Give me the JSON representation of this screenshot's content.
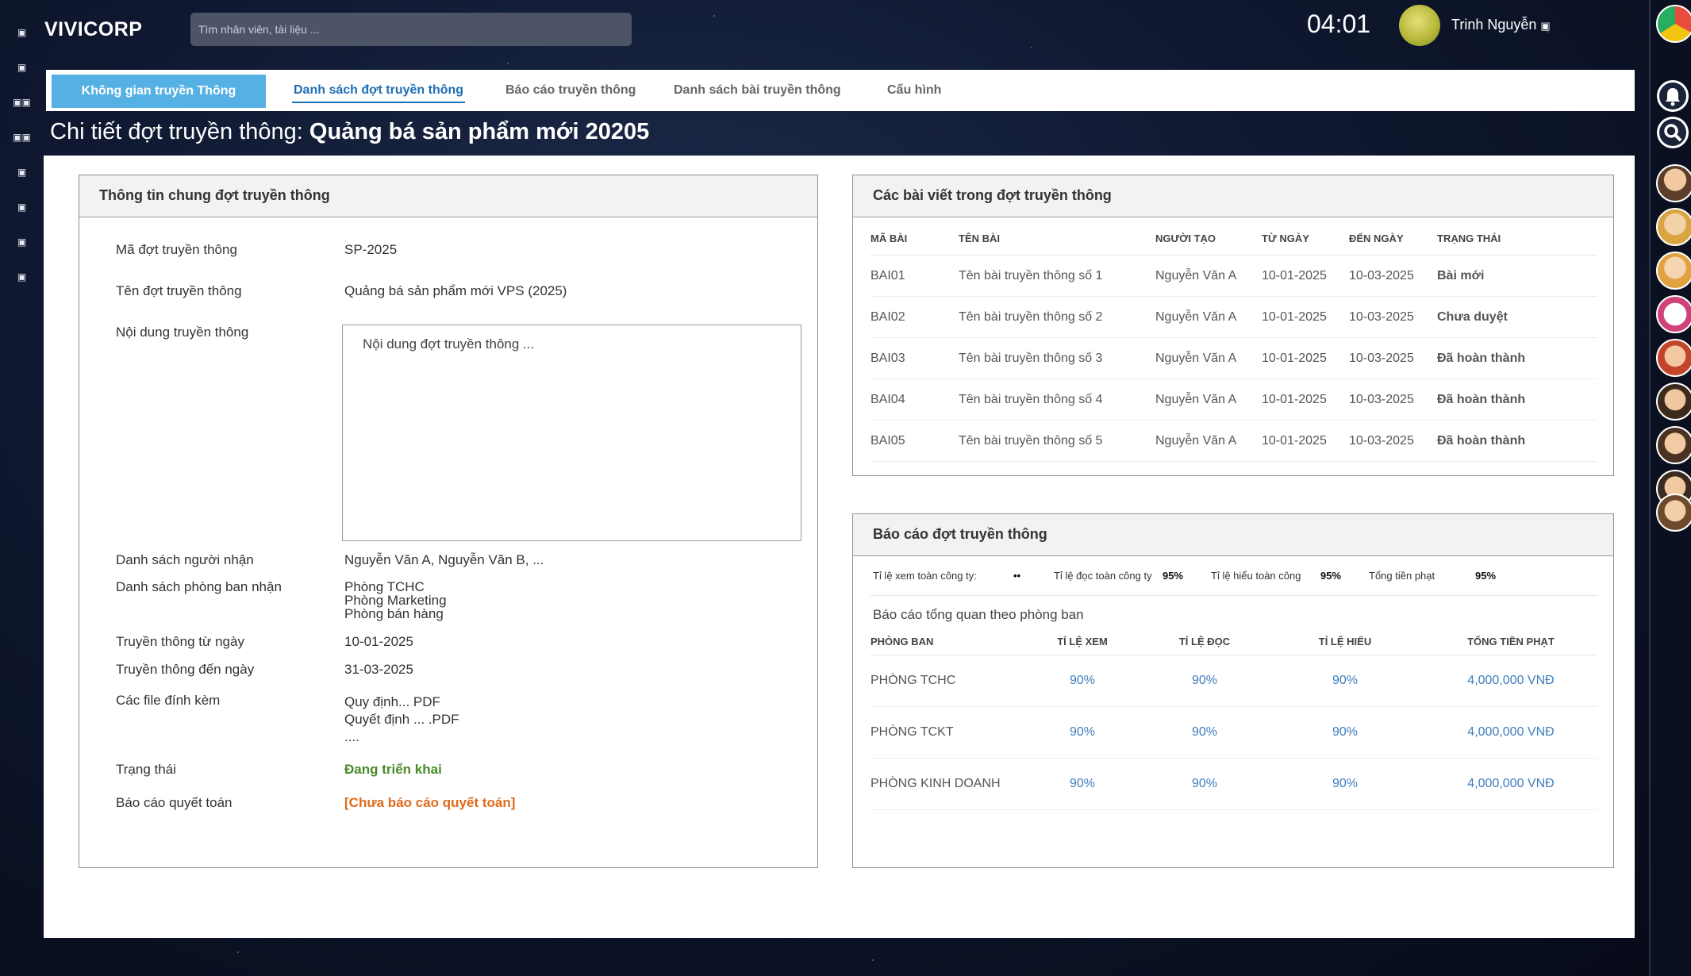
{
  "app": {
    "brand": "VIVICORP",
    "search_placeholder": "Tìm nhân viên, tài liệu ...",
    "clock": "04:01",
    "user_name": "Trinh Nguyễn"
  },
  "tabs": [
    {
      "label": "Không gian truyền Thông",
      "state": "active"
    },
    {
      "label": "Danh sách đợt truyền thông",
      "state": "current"
    },
    {
      "label": "Báo cáo truyền thông",
      "state": "normal"
    },
    {
      "label": "Danh sách bài truyền thông",
      "state": "normal"
    },
    {
      "label": "Cấu hình",
      "state": "normal"
    }
  ],
  "page": {
    "title_prefix": "Chi tiết đợt truyền thông:",
    "title_name": "Quảng bá sản phẩm mới 20205"
  },
  "general": {
    "header": "Thông tin chung đợt truyền thông",
    "code_label": "Mã đợt truyền thông",
    "code_value": "SP-2025",
    "name_label": "Tên đợt truyền thông",
    "name_value": "Quảng bá sản phẩm mới VPS (2025)",
    "content_label": "Nội dung truyền thông",
    "content_value": "Nội dung đợt truyền thông ...",
    "recipients_label": "Danh sách người nhận",
    "recipients_value": "Nguyễn Văn A, Nguyễn Văn B, ...",
    "depts_label": "Danh sách phòng ban nhận",
    "depts": [
      "Phòng TCHC",
      "Phòng Marketing",
      "Phòng bán hàng"
    ],
    "from_label": "Truyền thông từ ngày",
    "from_value": "10-01-2025",
    "to_label": "Truyền thông đến ngày",
    "to_value": "31-03-2025",
    "files_label": "Các file đính kèm",
    "files": [
      "Quy định... PDF",
      "Quyết định ... .PDF",
      "...."
    ],
    "status_label": "Trạng thái",
    "status_value": "Đang triển khai",
    "settlement_label": "Báo cáo quyết toán",
    "settlement_value": "[Chưa báo cáo quyết toán]"
  },
  "posts": {
    "header": "Các bài viết trong đợt truyền thông",
    "columns": [
      "MÃ BÀI",
      "TÊN BÀI",
      "NGƯỜI TẠO",
      "TỪ NGÀY",
      "ĐẾN NGÀY",
      "TRẠNG THÁI"
    ],
    "rows": [
      {
        "code": "BAI01",
        "name": "Tên bài truyền thông số 1",
        "creator": "Nguyễn Văn A",
        "from": "10-01-2025",
        "to": "10-03-2025",
        "status": "Bài mới",
        "kind": "new"
      },
      {
        "code": "BAI02",
        "name": "Tên bài truyền thông số 2",
        "creator": "Nguyễn Văn A",
        "from": "10-01-2025",
        "to": "10-03-2025",
        "status": "Chưa duyệt",
        "kind": "wait"
      },
      {
        "code": "BAI03",
        "name": "Tên bài truyền thông số 3",
        "creator": "Nguyễn Văn A",
        "from": "10-01-2025",
        "to": "10-03-2025",
        "status": "Đã hoàn thành",
        "kind": "done"
      },
      {
        "code": "BAI04",
        "name": "Tên bài truyền thông số 4",
        "creator": "Nguyễn Văn A",
        "from": "10-01-2025",
        "to": "10-03-2025",
        "status": "Đã hoàn thành",
        "kind": "done"
      },
      {
        "code": "BAI05",
        "name": "Tên bài truyền thông số 5",
        "creator": "Nguyễn Văn A",
        "from": "10-01-2025",
        "to": "10-03-2025",
        "status": "Đã hoàn thành",
        "kind": "done"
      }
    ]
  },
  "report": {
    "header": "Báo cáo đợt truyền thông",
    "kpis": [
      {
        "label": "Tỉ lệ xem toàn công ty:",
        "value": "••"
      },
      {
        "label": "Tỉ lệ đọc toàn công ty",
        "value": "95%"
      },
      {
        "label": "Tỉ lệ hiểu toàn công",
        "value": "95%"
      },
      {
        "label": "Tổng tiền phạt",
        "value": "95%"
      }
    ],
    "subheader": "Báo cáo tổng quan theo phòng ban",
    "columns": [
      "PHÒNG BAN",
      "TỈ LỆ XEM",
      "TỈ LỆ ĐỌC",
      "TỈ LỆ HIỂU",
      "TỔNG TIỀN PHẠT"
    ],
    "rows": [
      {
        "dept": "PHÒNG TCHC",
        "view": "90%",
        "read": "90%",
        "understand": "90%",
        "fine": "4,000,000 VNĐ"
      },
      {
        "dept": "PHÒNG TCKT",
        "view": "90%",
        "read": "90%",
        "understand": "90%",
        "fine": "4,000,000 VNĐ"
      },
      {
        "dept": "PHÒNG KINH DOANH",
        "view": "90%",
        "read": "90%",
        "understand": "90%",
        "fine": "4,000,000 VNĐ"
      }
    ]
  },
  "colors": {
    "accent_tab": "#55b0e3",
    "link": "#3d7dbe",
    "status_green": "#4a8a28",
    "status_orange": "#e06a1a",
    "status_blue": "#1f6fb4"
  },
  "icons": {
    "left_rail": [
      "menu-icon",
      "doc-icon",
      "grid-icon",
      "grid-icon",
      "doc-icon",
      "doc-icon",
      "doc-icon",
      "doc-icon"
    ],
    "right_rail": [
      "chrome-icon",
      "bell-icon",
      "search-icon",
      "avatar",
      "avatar",
      "avatar",
      "avatar",
      "avatar",
      "avatar",
      "avatar",
      "avatar"
    ]
  }
}
